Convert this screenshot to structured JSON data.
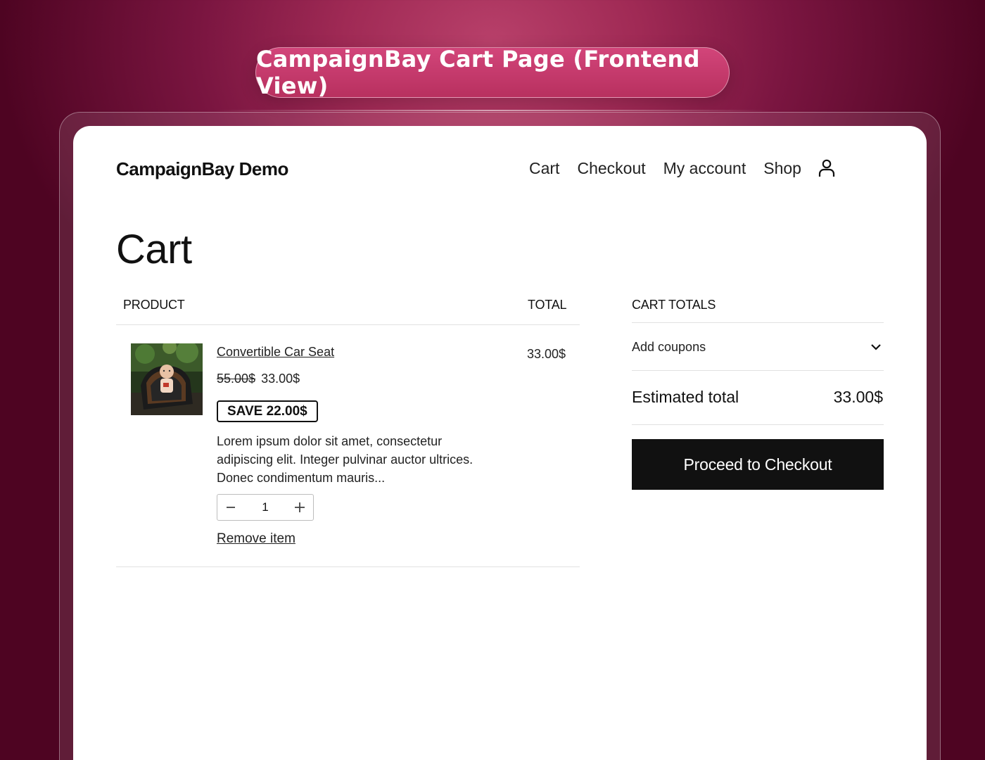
{
  "hero": {
    "title": "CampaignBay Cart Page (Frontend View)"
  },
  "site": {
    "brand": "CampaignBay Demo"
  },
  "nav": {
    "items": [
      {
        "label": "Cart"
      },
      {
        "label": "Checkout"
      },
      {
        "label": "My account"
      },
      {
        "label": "Shop"
      }
    ],
    "user_icon": "user-icon"
  },
  "page": {
    "title": "Cart"
  },
  "table": {
    "headers": {
      "product": "PRODUCT",
      "total": "TOTAL"
    },
    "items": [
      {
        "name": "Convertible Car Seat",
        "image": "product-photo",
        "old_price": "55.00$",
        "price": "33.00$",
        "save_badge": "SAVE 22.00$",
        "description": "Lorem ipsum dolor sit amet, consectetur adipiscing elit. Integer pulvinar auctor ultrices. Donec condimentum mauris...",
        "quantity": "1",
        "line_total": "33.00$",
        "remove_label": "Remove item"
      }
    ]
  },
  "totals": {
    "heading": "CART TOTALS",
    "coupons_label": "Add coupons",
    "estimated_label": "Estimated total",
    "estimated_value": "33.00$",
    "checkout_label": "Proceed to Checkout"
  },
  "colors": {
    "background": "#7a1540",
    "pill": "#c93a6e",
    "button": "#111111"
  }
}
